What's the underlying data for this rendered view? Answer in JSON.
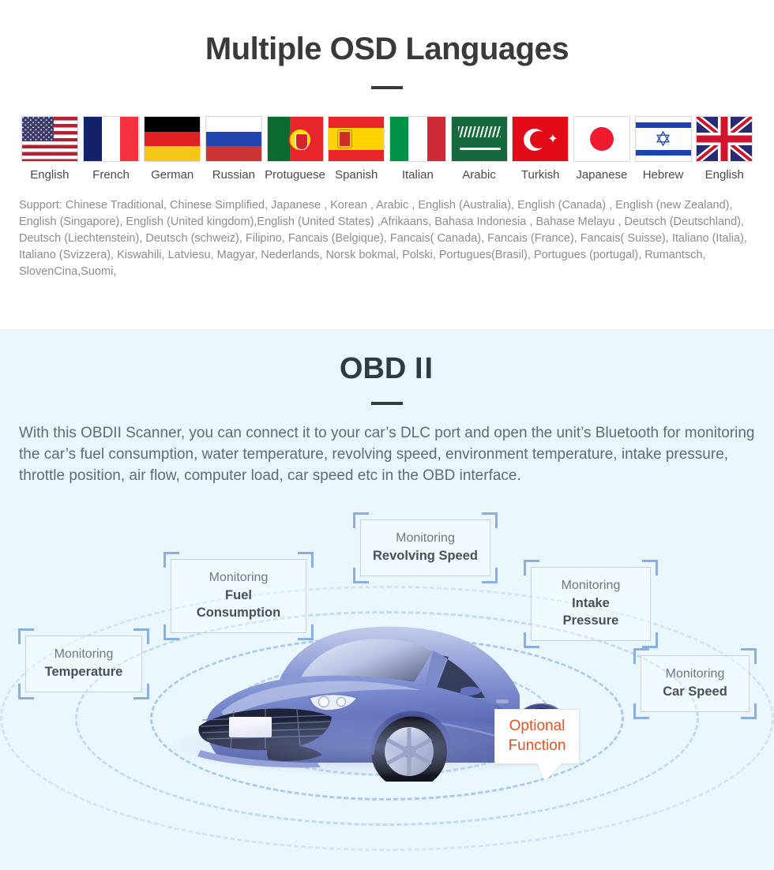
{
  "languages_section": {
    "title": "Multiple OSD Languages",
    "flags": [
      {
        "label": "English",
        "icon": "flag-us-icon"
      },
      {
        "label": "French",
        "icon": "flag-fr-icon"
      },
      {
        "label": "German",
        "icon": "flag-de-icon"
      },
      {
        "label": "Russian",
        "icon": "flag-ru-icon"
      },
      {
        "label": "Protuguese",
        "icon": "flag-pt-icon"
      },
      {
        "label": "Spanish",
        "icon": "flag-es-icon"
      },
      {
        "label": "Italian",
        "icon": "flag-it-icon"
      },
      {
        "label": "Arabic",
        "icon": "flag-sa-icon"
      },
      {
        "label": "Turkish",
        "icon": "flag-tr-icon"
      },
      {
        "label": "Japanese",
        "icon": "flag-jp-icon"
      },
      {
        "label": "Hebrew",
        "icon": "flag-il-icon"
      },
      {
        "label": "English",
        "icon": "flag-gb-icon"
      }
    ],
    "support_text": "Support: Chinese Traditional, Chinese Simplified, Japanese , Korean , Arabic , English (Australia), English (Canada) , English (new Zealand), English (Singapore), English (United kingdom),English (United States) ,Afrikaans, Bahasa Indonesia , Bahase Melayu , Deutsch (Deutschland), Deutsch (Liechtenstein), Deutsch (schweiz), Filipino, Fancais (Belgique), Fancais( Canada), Fancais (France), Fancais( Suisse), Italiano (Italia), Italiano (Svizzera), Kiswahili, Latviesu, Magyar, Nederlands, Norsk bokmal, Polski, Portugues(Brasil), Portugues (portugal), Rumantsch, SlovenCina,Suomi,"
  },
  "obd_section": {
    "title_main": "OBD",
    "title_numeral": "II",
    "description": "With this OBDII Scanner, you can connect it to your car’s DLC port and open the unit’s Bluetooth for monitoring the car’s fuel consumption, water temperature, revolving speed, environment temperature, intake pressure, throttle position, air flow, computer load, car speed etc in the OBD interface.",
    "callouts": [
      {
        "prefix": "Monitoring",
        "name": "Revolving Speed"
      },
      {
        "prefix": "Monitoring",
        "name": "Fuel Consumption"
      },
      {
        "prefix": "Monitoring",
        "name": "Temperature"
      },
      {
        "prefix": "Monitoring",
        "name": "Intake Pressure"
      },
      {
        "prefix": "Monitoring",
        "name": "Car Speed"
      }
    ],
    "bubble": {
      "line1": "Optional",
      "line2": "Function"
    }
  },
  "colors": {
    "section_bg": "#eaf7fd",
    "heading": "#3a3a3a",
    "body_text": "#5f6b76",
    "support_text": "#8d8d8d",
    "bracket_blue": "#8aaee0",
    "accent_orange": "#e8531f"
  }
}
